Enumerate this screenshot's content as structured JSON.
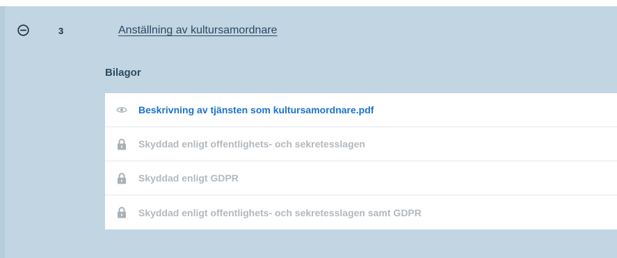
{
  "item": {
    "number": "3",
    "title": "Anställning av kultursamordnare"
  },
  "attachments_section": {
    "label": "Bilagor",
    "items": [
      {
        "icon": "eye-icon",
        "text": "Beskrivning av tjänsten som kultursamordnare.pdf",
        "type": "link"
      },
      {
        "icon": "lock-icon",
        "text": "Skyddad enligt offentlighets- och sekretesslagen",
        "type": "protected"
      },
      {
        "icon": "lock-icon",
        "text": "Skyddad enligt GDPR",
        "type": "protected"
      },
      {
        "icon": "lock-icon",
        "text": "Skyddad enligt offentlighets- och sekretesslagen samt GDPR",
        "type": "protected"
      }
    ]
  },
  "colors": {
    "panel_background": "#c1d5e2",
    "link": "#1a73c9",
    "protected_text": "#b3b9be",
    "icon_gray": "#a9b1b7"
  }
}
